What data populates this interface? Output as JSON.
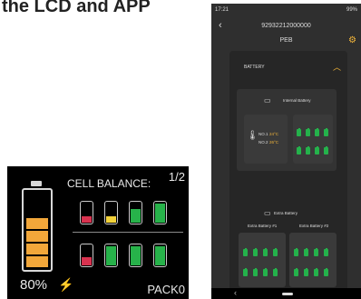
{
  "heading": "the LCD and APP",
  "lcd": {
    "title": "CELL BALANCE:",
    "page": "1/2",
    "percent": "80%",
    "pack": "PACK0",
    "bolt_icon": "lightning-bolt-icon",
    "colors": {
      "orange": "#f2a73a",
      "red": "#d8324f",
      "yellow": "#f2d23a",
      "green": "#27b24a",
      "empty": "#3a3a3a"
    }
  },
  "app": {
    "status_time": "17:21",
    "status_right": "99%",
    "title": "92932212000000",
    "subtitle": "PEB",
    "section_label": "BATTERY",
    "internal_label": "Internal Battery",
    "temp1_label": "NO.1",
    "temp1_value": "24°C",
    "temp2_label": "NO.2",
    "temp2_value": "26°C",
    "extra_label": "Extra Battery",
    "extra1": "Extra Battery #1",
    "extra2": "Extra Battery #2",
    "accent": "#f2b53a"
  }
}
